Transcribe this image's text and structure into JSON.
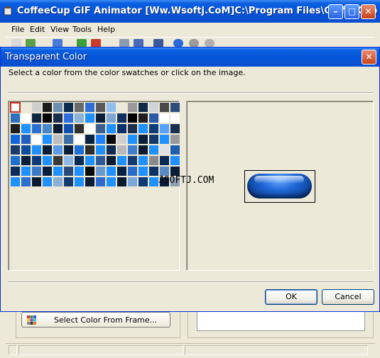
{
  "app": {
    "title": "CoffeeCup GIF Animator [Ww.Wsoftj.CoM]C:\\Program Files\\CoffeeCup S...",
    "menu": [
      "File",
      "Edit",
      "View",
      "Tools",
      "Help"
    ],
    "select_frame_button": "Select Color From Frame..."
  },
  "dialog": {
    "title": "Transparent Color",
    "instruction": "Select a color from the color swatches or click on the image.",
    "ok_label": "OK",
    "cancel_label": "Cancel",
    "watermark": "JSOFTJ.COM",
    "selected_swatch_index": 0,
    "swatch_colors": [
      "#ffffff",
      "#ece9d8",
      "#cfcfcf",
      "#1c1c1c",
      "#6f8fb0",
      "#0a2a52",
      "#6a6a6a",
      "#2d6fd6",
      "#5a5a5a",
      "#8fbfee",
      "#ece9d8",
      "#9a9a9a",
      "#122a4a",
      "#cfd4d8",
      "#4a4a4a",
      "#2b4f7a",
      "#2f6fc0",
      "#ffffff",
      "#0e2440",
      "#000000",
      "#1a2f50",
      "#2e6fe0",
      "#8cb2d8",
      "#1e90ff",
      "#0a1e3a",
      "#7fa6cf",
      "#0f2f5f",
      "#000000",
      "#1e1e1e",
      "#2a5aa8",
      "#ffffff",
      "#ffffff",
      "#1c1c1c",
      "#1e90ff",
      "#2a70d0",
      "#4a86c8",
      "#0a1a33",
      "#0f4fb0",
      "#2f2f2f",
      "#ffffff",
      "#3a5f8f",
      "#1e90ff",
      "#0a2f6a",
      "#1e2f4a",
      "#1e90ff",
      "#0e3a7a",
      "#5aa2ff",
      "#1a2f4f",
      "#0f66d8",
      "#2060c0",
      "#ffffff",
      "#1e90ff",
      "#bdbdbd",
      "#3a6ea8",
      "#ffffff",
      "#0a2244",
      "#1e80ff",
      "#0a0a0a",
      "#cfcfcf",
      "#1e90ff",
      "#0a1f3a",
      "#153a6a",
      "#1e90ff",
      "#9a9a9a",
      "#1a3a6a",
      "#0f4c9c",
      "#1e90ff",
      "#0a1e38",
      "#5a9ae8",
      "#0a1e3a",
      "#1e6fd8",
      "#2c2c2c",
      "#1e90ff",
      "#0e2a52",
      "#b8b8b8",
      "#3f7fd0",
      "#0a1a30",
      "#1e90ff",
      "#e0e0e0",
      "#1f5fb0",
      "#1f6fd0",
      "#0a1e3a",
      "#0d3a7a",
      "#1e90ff",
      "#3a3a3a",
      "#8fb8e8",
      "#0a2a56",
      "#1e90ff",
      "#2e5a9a",
      "#0a1a30",
      "#1e90ff",
      "#143a70",
      "#1e90ff",
      "#8a8a8a",
      "#0a2a55",
      "#1e90ff",
      "#0c2c5c",
      "#1e90ff",
      "#3b78c8",
      "#0a1e3a",
      "#1e90ff",
      "#2a4a7a",
      "#1e90ff",
      "#0a0a0a",
      "#6a9ad0",
      "#1e90ff",
      "#0a2244",
      "#2a6ac8",
      "#1e90ff",
      "#0e3266",
      "#5a8ac0",
      "#0a1e3a",
      "#1e90ff",
      "#2f6fd0",
      "#0a1a30",
      "#1e90ff",
      "#8ab0d8",
      "#153a70",
      "#1e90ff",
      "#0a1e3a",
      "#2e6ad0",
      "#1e90ff",
      "#0a1a33",
      "#7aa8dc",
      "#0f3a78",
      "#1e90ff",
      "#0a1e3a",
      "#8fa0b4"
    ]
  }
}
